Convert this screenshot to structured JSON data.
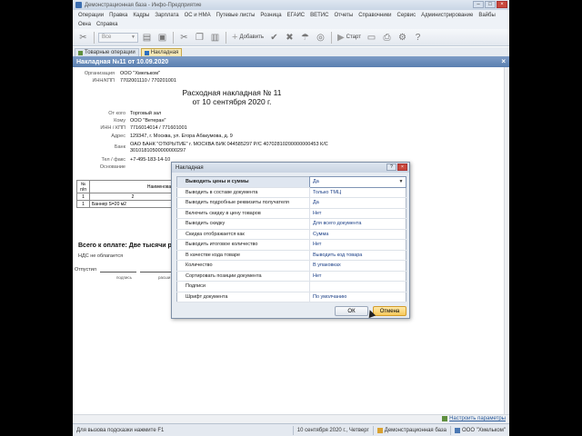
{
  "window": {
    "title": "Демонстрационная база - Инфо-Предприятие"
  },
  "menu": {
    "items": [
      "Операции",
      "Правка",
      "Кадры",
      "Зарплата",
      "ОС и НМА",
      "Путевые листы",
      "Розница",
      "ЕГАИС",
      "ВЕТИС",
      "Отчеты",
      "Справочники",
      "Сервис",
      "Администрирование",
      "Вайбы"
    ],
    "row2": [
      "Окна",
      "Справка"
    ]
  },
  "toolbar": {
    "combo_value": "Все",
    "add_label": "Добавить",
    "start_label": "Старт"
  },
  "tabs": [
    {
      "label": "Товарные операции"
    },
    {
      "label": "Накладная"
    }
  ],
  "document": {
    "title_bar": "Накладная №11 от 10.09.2020",
    "org_label": "Организация",
    "org_value": "ООО \"Хмельком\"",
    "inn_label": "ИНН/КПП",
    "inn_value": "7702001110 / 770201001",
    "heading_line1": "Расходная накладная № 11",
    "heading_line2": "от 10 сентября 2020 г.",
    "from_label": "От кого",
    "from_value": "Торговый зал",
    "to_label": "Кому",
    "to_value": "ООО \"Ветеран\"",
    "inn2_label": "ИНН / КПП",
    "inn2_value": "7716014014 / 771601001",
    "address_label": "Адрес",
    "address_value": "129347, г. Москва, ул. Егора Абакумова, д. 9",
    "bank_label": "Банк",
    "bank_value1": "ОАО БАНК \"ОТКРЫТИЕ\" г. МОСКВА  БИК 044585297 Р/С 40702810200000000453 К/С",
    "bank_value2": "30101810500000000297",
    "phone_label": "Тел / факс",
    "phone_value": "+7-495-183-14-10",
    "basis_label": "Основание",
    "table_header_num": "№ п/п",
    "table_header_name": "Наименован",
    "table_sub_1": "1",
    "table_sub_2": "2",
    "row1_num": "1",
    "row1_name": "Баннер S=20 м2",
    "total_text": "Всего к оплате: Две тысячи р",
    "nds_text": "НДС не облагается",
    "released_label": "Отпустил",
    "sign_caption": "подпись",
    "decode_caption": "расши"
  },
  "dialog": {
    "title": "Накладная",
    "rows": [
      {
        "key": "Выводить цены и суммы",
        "value": "Да"
      },
      {
        "key": "Выводить в составе документа",
        "value": "Только ТМЦ"
      },
      {
        "key": "Выводить подробные реквизиты получателя",
        "value": "Да"
      },
      {
        "key": "Включить скидку в цену товаров",
        "value": "Нет"
      },
      {
        "key": "Выводить скидку",
        "value": "Для всего документа"
      },
      {
        "key": "Скидка отображается как",
        "value": "Сумма"
      },
      {
        "key": "Выводить итоговое количество",
        "value": "Нет"
      },
      {
        "key": "В качестве кода товаре",
        "value": "Выводить код товара"
      },
      {
        "key": "Количество",
        "value": "В упаковках"
      },
      {
        "key": "Сортировать позиции документа",
        "value": "Нет"
      },
      {
        "key": "Подписи",
        "value": ""
      },
      {
        "key": "Шрифт документа",
        "value": "По умолчанию"
      }
    ],
    "ok_label": "ОК",
    "cancel_label": "Отмена"
  },
  "statusbar": {
    "hint": "Для вызова подсказки нажмите F1",
    "date": "10 сентября 2020 г., Четверг",
    "db": "Демонстрационная база",
    "org": "ООО \"Хмельком\"",
    "settings_link": "Настроить параметры"
  }
}
